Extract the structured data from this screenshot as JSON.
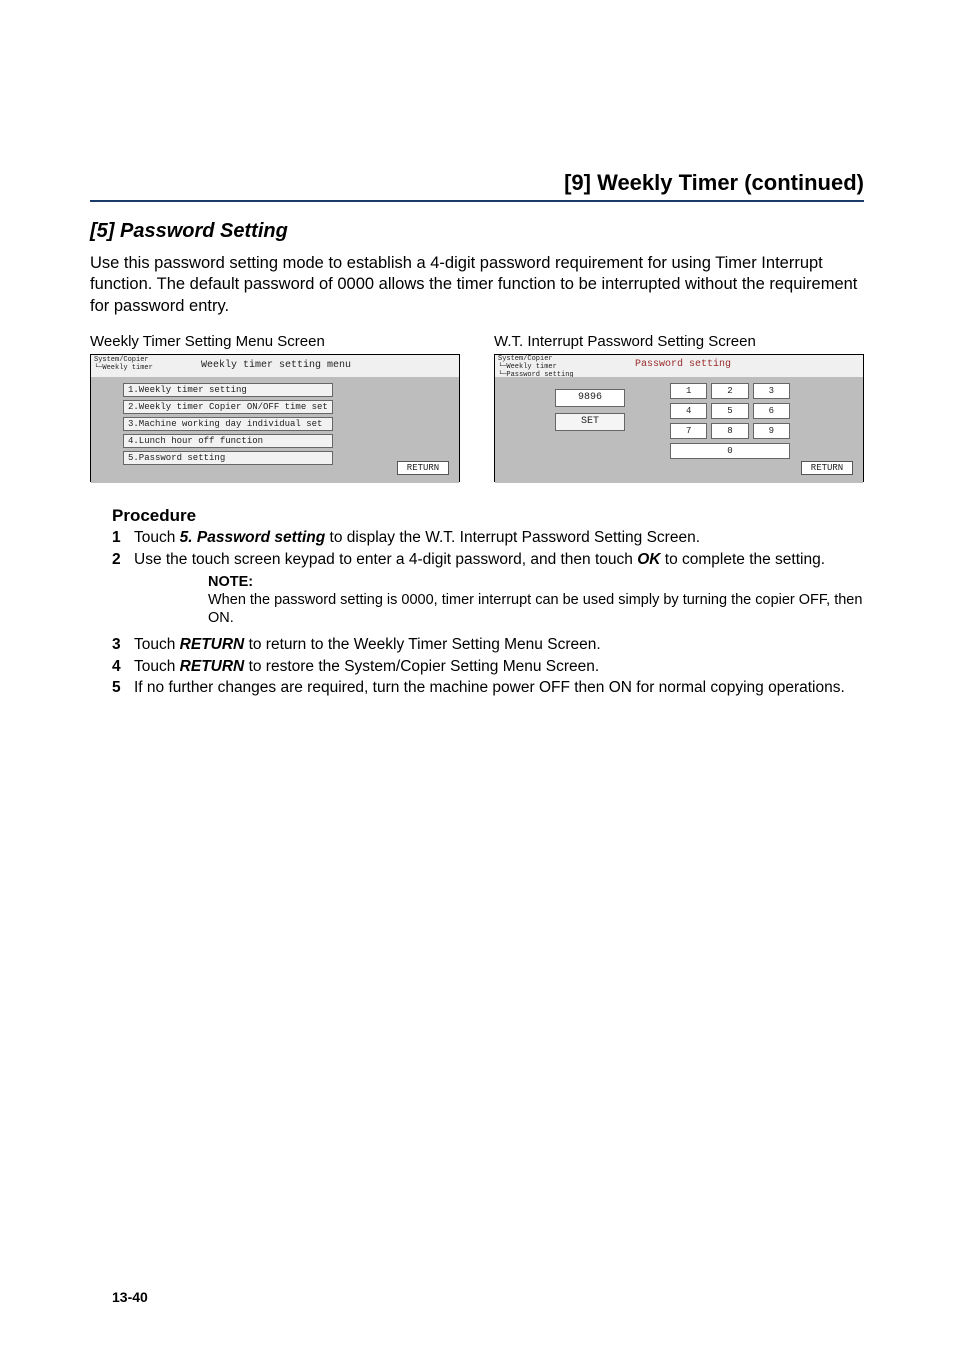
{
  "header": "[9] Weekly Timer (continued)",
  "section": "[5] Password Setting",
  "intro": "Use this password setting mode to establish a 4-digit password requirement for using Timer Interrupt function. The default password of 0000 allows the timer function to be interrupted without the requirement for password entry.",
  "left_screen": {
    "caption": "Weekly Timer Setting Menu Screen",
    "crumb1": "System/Copier",
    "crumb2": "└─Weekly timer",
    "title": "Weekly timer setting menu",
    "items": [
      "1.Weekly timer setting",
      "2.Weekly timer Copier ON/OFF time set",
      "3.Machine working day individual set",
      "4.Lunch hour off function",
      "5.Password setting"
    ],
    "return": "RETURN"
  },
  "right_screen": {
    "caption": "W.T. Interrupt Password Setting Screen",
    "crumb1": "System/Copier",
    "crumb2": "└─Weekly timer",
    "crumb3": "  └─Password setting",
    "title": "Password setting",
    "display": "9896",
    "set": "SET",
    "keys": [
      "1",
      "2",
      "3",
      "4",
      "5",
      "6",
      "7",
      "8",
      "9",
      "0"
    ],
    "return": "RETURN"
  },
  "procedure": {
    "label": "Procedure",
    "step1": {
      "num": "1",
      "bold": "5. Password setting",
      "pre": "Touch ",
      "post": " to display the W.T. Interrupt Password Setting Screen."
    },
    "step2": {
      "num": "2",
      "pre": "Use the touch screen keypad to enter a 4-digit password, and then touch ",
      "bold": "OK",
      "post": " to complete the setting."
    },
    "note": {
      "label": "NOTE:",
      "text": "When the password setting is 0000, timer interrupt can be used simply by turning the copier OFF, then ON."
    },
    "step3": {
      "num": "3",
      "pre": "Touch ",
      "bold": "RETURN",
      "post": " to return to the Weekly Timer Setting Menu Screen."
    },
    "step4": {
      "num": "4",
      "pre": "Touch ",
      "bold": "RETURN",
      "post": " to restore the System/Copier Setting Menu Screen."
    },
    "step5": {
      "num": "5",
      "text": "If no further changes are required, turn the machine power OFF then ON for normal copying operations."
    }
  },
  "page_number": "13-40"
}
